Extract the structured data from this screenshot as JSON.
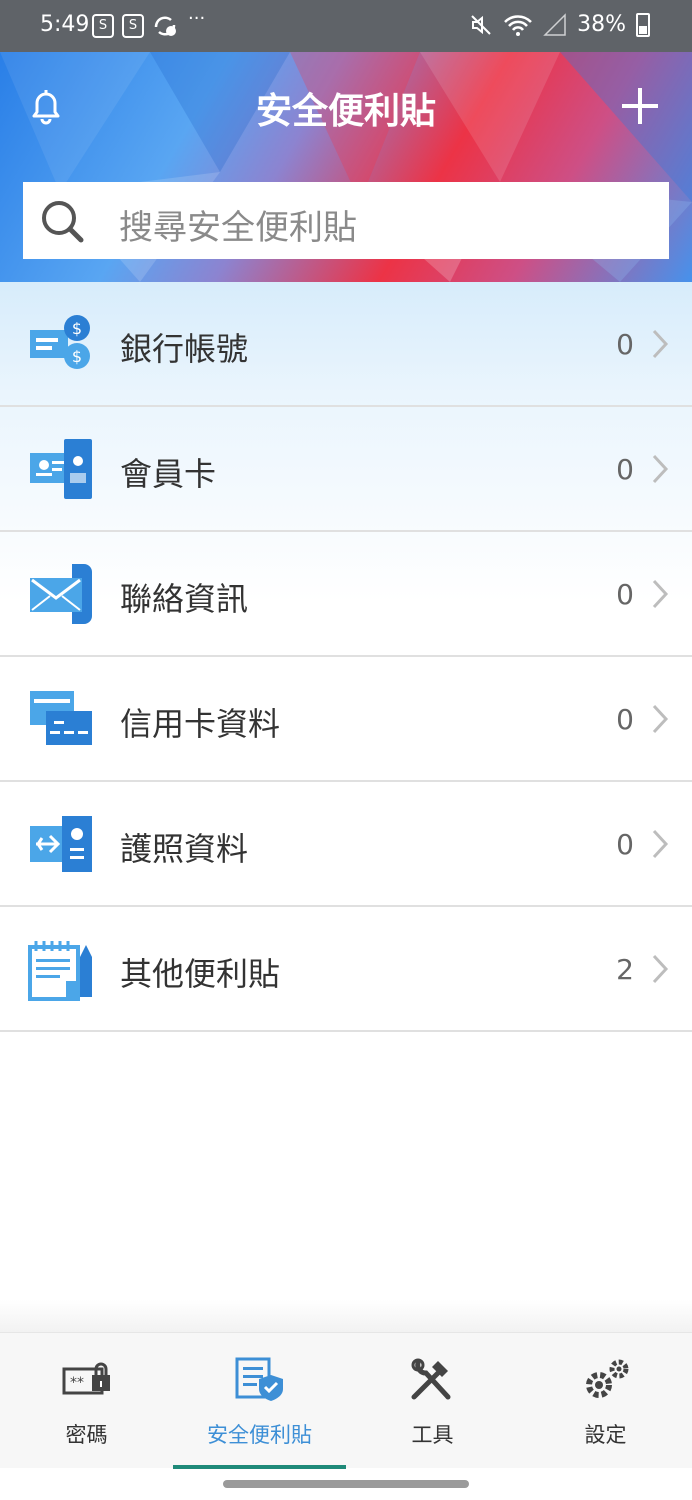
{
  "status_bar": {
    "time": "5:49",
    "app_icon_letter": "S",
    "more": "···",
    "battery": "38%"
  },
  "header": {
    "title": "安全便利貼",
    "add_icon": "plus-icon",
    "bell_icon": "bell-icon"
  },
  "search": {
    "placeholder": "搜尋安全便利貼"
  },
  "categories": [
    {
      "label": "銀行帳號",
      "count": "0",
      "icon": "bank-account-icon"
    },
    {
      "label": "會員卡",
      "count": "0",
      "icon": "membership-card-icon"
    },
    {
      "label": "聯絡資訊",
      "count": "0",
      "icon": "contact-info-icon"
    },
    {
      "label": "信用卡資料",
      "count": "0",
      "icon": "credit-card-icon"
    },
    {
      "label": "護照資料",
      "count": "0",
      "icon": "passport-icon"
    },
    {
      "label": "其他便利貼",
      "count": "2",
      "icon": "other-notes-icon"
    }
  ],
  "nav": [
    {
      "label": "密碼",
      "icon": "password-lock-icon"
    },
    {
      "label": "安全便利貼",
      "icon": "secure-notes-icon",
      "active": true
    },
    {
      "label": "工具",
      "icon": "tools-icon"
    },
    {
      "label": "設定",
      "icon": "settings-gear-icon"
    }
  ],
  "colors": {
    "accent_blue": "#3d8fd6",
    "icon_blue": "#4ba6e8",
    "active_indicator": "#1f8a79"
  }
}
